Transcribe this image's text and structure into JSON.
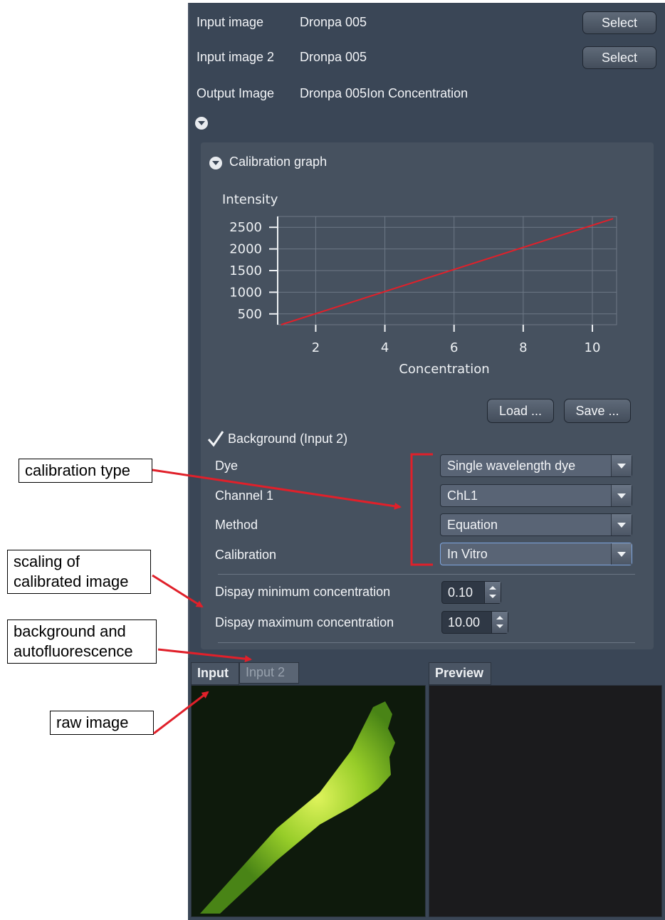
{
  "header": {
    "input_label": "Input image",
    "input_value": "Dronpa 005",
    "input_button": "Select",
    "input2_label": "Input image 2",
    "input2_value": "Dronpa 005",
    "input2_button": "Select",
    "output_label": "Output Image",
    "output_value": "Dronpa 005Ion Concentration"
  },
  "calibration_graph": {
    "section_title": "Calibration graph",
    "load_button": "Load ...",
    "save_button": "Save ..."
  },
  "chart_data": {
    "type": "line",
    "ylabel": "Intensity",
    "xlabel": "Concentration",
    "x_ticks": [
      2,
      4,
      6,
      8,
      10
    ],
    "y_ticks": [
      500,
      1000,
      1500,
      2000,
      2500
    ],
    "xlim": [
      0.9,
      10.7
    ],
    "ylim": [
      250,
      2750
    ],
    "series": [
      {
        "x": [
          1,
          10.6
        ],
        "y": [
          250,
          2700
        ],
        "color": "#e0202a"
      }
    ]
  },
  "background": {
    "label": "Background (Input 2)",
    "checked": true
  },
  "fields": {
    "dye_label": "Dye",
    "dye_value": "Single wavelength dye",
    "channel_label": "Channel 1",
    "channel_value": "ChL1",
    "method_label": "Method",
    "method_value": "Equation",
    "calibration_label": "Calibration",
    "calibration_value": "In Vitro",
    "min_label": "Dispay minimum concentration",
    "min_value": "0.10",
    "max_label": "Dispay maximum concentration",
    "max_value": "10.00"
  },
  "tabs": {
    "input_tab": "Input",
    "input2_tab": "Input 2",
    "preview_tab": "Preview"
  },
  "callouts": {
    "calibration_type": "calibration type",
    "scaling_line1": "scaling of",
    "scaling_line2": "calibrated image",
    "background_line1": "background and",
    "background_line2": "autofluorescence",
    "raw_image": "raw image"
  },
  "colors": {
    "annotation_red": "#e0202a",
    "panel_bg": "#3a4656",
    "fluorescence": "#9ed62a"
  }
}
